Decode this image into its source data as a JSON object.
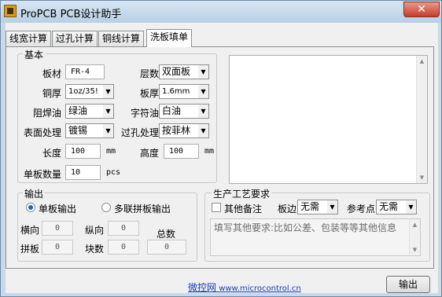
{
  "window": {
    "title": "ProPCB PCB设计助手",
    "close_label": "✕"
  },
  "tabs": [
    "线宽计算",
    "过孔计算",
    "铜线计算",
    "洗板填单"
  ],
  "basic": {
    "title": "基本",
    "material_label": "板材",
    "material_value": "FR-4",
    "layers_label": "层数",
    "layers_value": "双面板",
    "copper_label": "铜厚",
    "copper_value": "1oz/35!",
    "thickness_label": "板厚",
    "thickness_value": "1.6mm",
    "mask_label": "阻焊油",
    "mask_value": "绿油",
    "silk_label": "字符油",
    "silk_value": "白油",
    "finish_label": "表面处理",
    "finish_value": "镀锡",
    "via_label": "过孔处理",
    "via_value": "按菲林",
    "length_label": "长度",
    "length_value": "100",
    "length_unit": "mm",
    "width_label": "高度",
    "width_value": "100",
    "width_unit": "mm",
    "qty_label": "单板数量",
    "qty_value": "10",
    "qty_unit": "pcs"
  },
  "output": {
    "title": "输出",
    "single_label": "单板输出",
    "panel_label": "多联拼板输出",
    "horiz_label": "横向",
    "horiz_value": "0",
    "vert_label": "纵向",
    "vert_value": "0",
    "total_label": "总数",
    "total_value": "0",
    "panel_qty_label": "拼板",
    "panel_qty_value": "0",
    "blocks_label": "块数",
    "blocks_value": "0"
  },
  "process": {
    "title": "生产工艺要求",
    "other_note_label": "其他备注",
    "edge_label": "板边",
    "edge_value": "无需",
    "ref_label": "参考点",
    "ref_value": "无需",
    "notes_placeholder": "填写其他要求:比如公差、包装等等其他信息"
  },
  "footer": {
    "link_cn": "微控网",
    "link_url": "www.microcontrol.cn",
    "export_label": "输出"
  },
  "icons": {
    "dropdown": "chevron-down-icon",
    "scroll_up": "scroll-up-icon",
    "scroll_down": "scroll-down-icon"
  }
}
